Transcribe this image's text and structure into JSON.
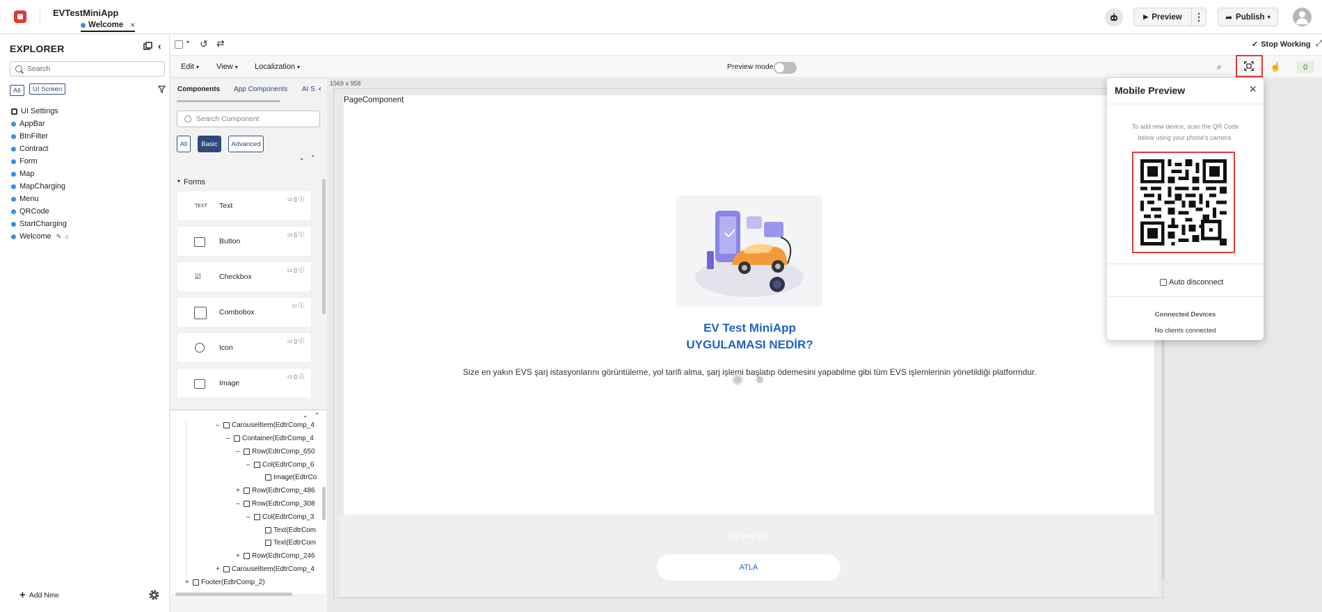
{
  "header": {
    "app_name": "EVTestMiniApp",
    "tab": "Welcome",
    "tab_close": "×",
    "preview_label": "Preview",
    "publish_label": "Publish"
  },
  "toolbar": {
    "stop_working": "Stop Working",
    "preview_mode": "Preview mode",
    "menus": [
      "Edit",
      "View",
      "Localization"
    ],
    "counter": "0"
  },
  "explorer": {
    "title": "EXPLORER",
    "search_placeholder": "Search",
    "filters": [
      "All",
      "UI Screen"
    ],
    "items": [
      "UI Settings",
      "AppBar",
      "BtnFilter",
      "Contract",
      "Form",
      "Map",
      "MapCharging",
      "Menu",
      "QRCode",
      "StartCharging",
      "Welcome"
    ],
    "add_new": "Add New"
  },
  "components": {
    "tabs": [
      "Components",
      "App Components",
      "AI S"
    ],
    "search_placeholder": "Search Component",
    "filters": [
      "All",
      "Basic",
      "Advanced"
    ],
    "section": "Forms",
    "items": [
      {
        "label": "Text",
        "icon_text": "TEXT"
      },
      {
        "label": "Button",
        "icon_text": ""
      },
      {
        "label": "Checkbox",
        "icon_text": ""
      },
      {
        "label": "Combobox",
        "icon_text": ""
      },
      {
        "label": "Icon",
        "icon_text": ""
      },
      {
        "label": "Image",
        "icon_text": ""
      }
    ]
  },
  "tree": {
    "rows": [
      {
        "toggle": "–",
        "label": "CarouselItem(EdtrComp_4"
      },
      {
        "toggle": "–",
        "label": "Container(EdtrComp_4"
      },
      {
        "toggle": "–",
        "label": "Row(EdtrComp_650"
      },
      {
        "toggle": "–",
        "label": "Col(EdtrComp_6"
      },
      {
        "toggle": "",
        "label": "Image(EdtrCo"
      },
      {
        "toggle": "+",
        "label": "Row(EdtrComp_486"
      },
      {
        "toggle": "–",
        "label": "Row(EdtrComp_308"
      },
      {
        "toggle": "–",
        "label": "Col(EdtrComp_3"
      },
      {
        "toggle": "",
        "label": "Text(EdtrCom"
      },
      {
        "toggle": "",
        "label": "Text(EdtrCom"
      },
      {
        "toggle": "+",
        "label": "Row(EdtrComp_246"
      },
      {
        "toggle": "+",
        "label": "CarouselItem(EdtrComp_4"
      },
      {
        "toggle": "+",
        "label": "Footer(EdtrComp_2)"
      }
    ]
  },
  "canvas": {
    "size_label": "1569 x 958",
    "page_label": "PageComponent",
    "title_line1": "EV Test MiniApp",
    "title_line2": "UYGULAMASI NEDİR?",
    "description": "Size en yakın EVS şarj istasyonlarını görüntüleme, yol tarifi alma, şarj işlemi başlatıp ödemesini yapabilme gibi tüm EVS işlemlerinin yönetildiği platformdur.",
    "devam_label": "DEVAM ET",
    "atla_label": "ATLA"
  },
  "mobile_preview": {
    "title": "Mobile Preview",
    "instructions": "To add new device, scan the QR Code below using your phone's camera.",
    "auto_disconnect": "Auto disconnect",
    "connected_title": "Connected Devices",
    "connected_status": "No clients connected"
  },
  "colors": {
    "accent": "#2d4a7a",
    "brand": "#e8372b",
    "title_blue": "#1a63c8",
    "highlight": "#e53935"
  }
}
